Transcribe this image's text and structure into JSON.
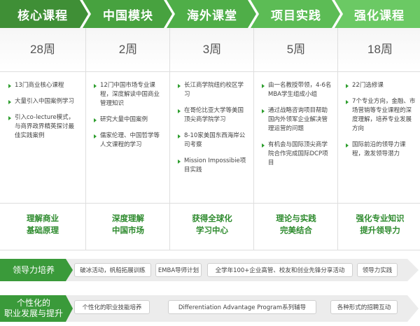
{
  "colors": {
    "stage_fills": [
      "#3f8f36",
      "#47a23f",
      "#4fae48",
      "#5cbc55",
      "#6bc964"
    ],
    "bar_label": "#3a9a3a",
    "bar_body": "#ececec",
    "outcome_text": "#2e8b2e"
  },
  "stages": [
    {
      "title": "核心课程",
      "weeks": "28周",
      "items": [
        "13门商业核心课程",
        "大量引入中国案例学习",
        "引入co-lecture模式，与商界政界精英探讨最佳实践案例"
      ],
      "outcome": [
        "理解商业",
        "基础原理"
      ]
    },
    {
      "title": "中国模块",
      "weeks": "2周",
      "items": [
        "12门中国市场专业课程，深度解读中国商业管理知识",
        "研究大量中国案例",
        "儒家伦理、中国哲学等人文课程的学习"
      ],
      "outcome": [
        "深度理解",
        "中国市场"
      ]
    },
    {
      "title": "海外课堂",
      "weeks": "3周",
      "items": [
        "长江商学院纽约校区学习",
        "在哥伦比亚大学等美国顶尖商学院学习",
        "8-10家美国东西海岸公司考察",
        "Mission Impossibie项目实践"
      ],
      "outcome": [
        "获得全球化",
        "学习中心"
      ]
    },
    {
      "title": "项目实践",
      "weeks": "5周",
      "items": [
        "由一名教授带领，4-6名MBA学生组成小组",
        "通过战略咨询项目帮助国内外领军企业解决管理运营的问题",
        "有机会与国际顶尖商学院合作完成国际DCP项目"
      ],
      "outcome": [
        "理论与实践",
        "完美结合"
      ]
    },
    {
      "title": "强化课程",
      "weeks": "18周",
      "items": [
        "22门选修课",
        "7个专业方向，金融、市场营销等专业课程的深度理解，培养专业发展方向",
        "国际前沿的领导力课程，激发领导潜力"
      ],
      "outcome": [
        "强化专业知识",
        "提升领导力"
      ]
    }
  ],
  "leadership_bar": {
    "label": "领导力培养",
    "tags": [
      "破冰活动，帆船拓展训练",
      "EMBA导师计划",
      "全学年100+企业高管、校友和创业先锋分享活动",
      "领导力实践"
    ]
  },
  "career_bar": {
    "label": [
      "个性化的",
      "职业发展与提升"
    ],
    "tags": [
      "个性化的职业技能培养",
      "Differentiation Advantage Program系列辅导",
      "各种形式的招聘互动"
    ]
  }
}
